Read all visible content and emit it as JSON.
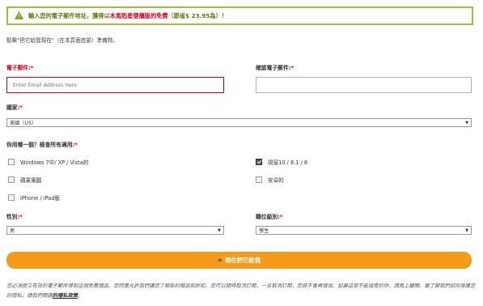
{
  "banner": {
    "part1": "輸入您的電子郵件地址，獲得以",
    "highlight": "木馬剋星便攜版的免費",
    "part2": "（節省$ 23.95為）！"
  },
  "intro": "點擊\"把它給我現在\"（在本頁面底部）準備時。",
  "email": {
    "label": "電子郵件",
    "placeholder": "Enter Email Address Here",
    "value": ""
  },
  "confirm_email": {
    "label": "確認電子郵件",
    "value": ""
  },
  "country": {
    "label": "國家",
    "value": "美國（US）"
  },
  "os": {
    "label": "你用哪一個？檢查所有適用",
    "options": [
      {
        "label": "Windows 7中/ XP / Vista的",
        "checked": false
      },
      {
        "label": "視窗10 / 8.1 / 8",
        "checked": true
      },
      {
        "label": "蘋果電腦",
        "checked": false
      },
      {
        "label": "安卓的",
        "checked": false
      },
      {
        "label": "iPhone / iPad版",
        "checked": false
      }
    ]
  },
  "gender": {
    "label": "性別",
    "value": "男"
  },
  "job_level": {
    "label": "職位級別",
    "value": "學生"
  },
  "submit_label": "現在把它給我",
  "footer": {
    "text": "您必須提交有效的電子郵件得到這個免費禮品。您同意允許我們讓您了解新的贈品和折扣。您可以隨時取消訂閱，一旦取消訂閱，您將不會再增加。如果這是不能接受的你，請馬上離開。要了解我們如何保護您的隱私，請我們閱讀",
    "link": "的隱私政策",
    "end": "。"
  },
  "colors": {
    "accent": "#f59a1b",
    "error": "#d0021b",
    "banner_border": "#9fbf3b"
  }
}
